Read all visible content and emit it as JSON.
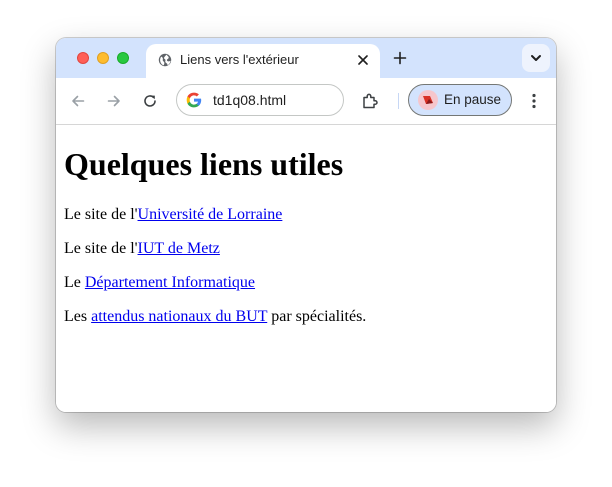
{
  "tab": {
    "title": "Liens vers l'extérieur"
  },
  "toolbar": {
    "url": "td1q08.html",
    "profile_label": "En pause"
  },
  "page": {
    "heading": "Quelques liens utiles",
    "lines": [
      {
        "before": "Le site de l'",
        "link": "Université de Lorraine",
        "after": ""
      },
      {
        "before": "Le site de l'",
        "link": "IUT de Metz",
        "after": ""
      },
      {
        "before": "Le ",
        "link": "Département Informatique",
        "after": ""
      },
      {
        "before": "Les ",
        "link": "attendus nationaux du BUT",
        "after": " par spécialités."
      }
    ]
  },
  "colors": {
    "tabstrip": "#d3e3fd",
    "link": "#0000ee",
    "profile_pill": "#d3e3fd"
  },
  "icons": [
    "globe-icon",
    "close-icon",
    "plus-icon",
    "chevron-down-icon",
    "back-arrow-icon",
    "forward-arrow-icon",
    "reload-icon",
    "google-icon",
    "extensions-icon",
    "kebab-menu-icon"
  ]
}
